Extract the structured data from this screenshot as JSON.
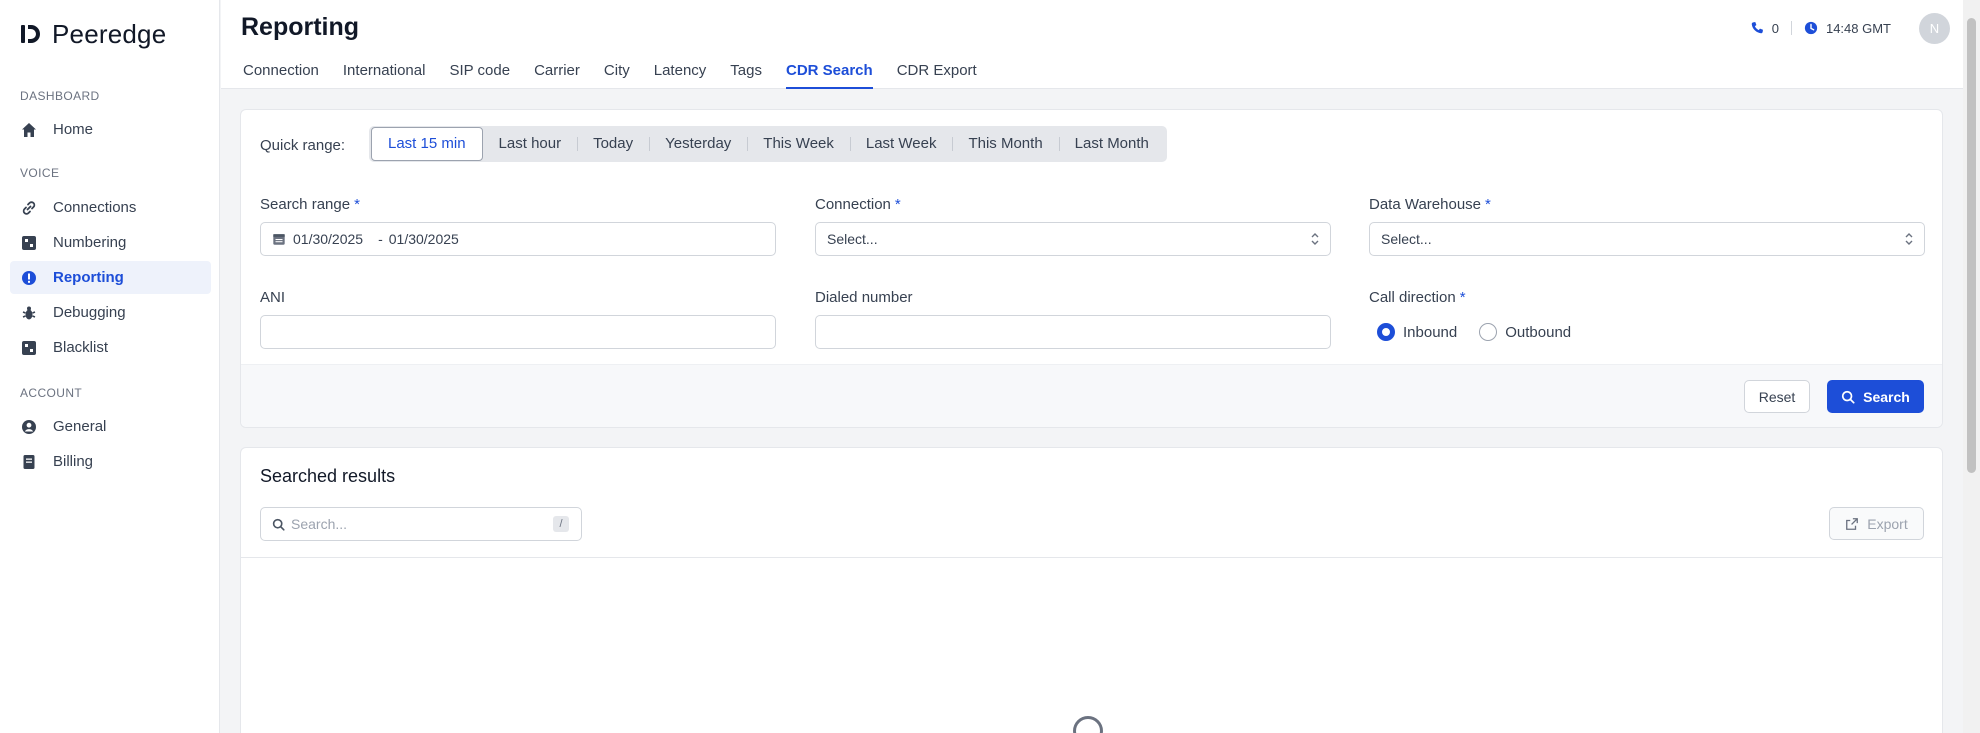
{
  "brand": {
    "name": "Peeredge"
  },
  "sidebar": {
    "sections": [
      {
        "title": "DASHBOARD"
      },
      {
        "title": "VOICE"
      },
      {
        "title": "ACCOUNT"
      }
    ],
    "items": [
      {
        "label": "Home",
        "icon": "home-icon"
      },
      {
        "label": "Connections",
        "icon": "link-icon"
      },
      {
        "label": "Numbering",
        "icon": "grid-icon"
      },
      {
        "label": "Reporting",
        "icon": "alert-circle-icon",
        "active": true
      },
      {
        "label": "Debugging",
        "icon": "bug-icon"
      },
      {
        "label": "Blacklist",
        "icon": "grid-icon"
      },
      {
        "label": "General",
        "icon": "user-circle-icon"
      },
      {
        "label": "Billing",
        "icon": "document-icon"
      }
    ]
  },
  "header": {
    "title": "Reporting",
    "tabs": [
      {
        "label": "Connection"
      },
      {
        "label": "International"
      },
      {
        "label": "SIP code"
      },
      {
        "label": "Carrier"
      },
      {
        "label": "City"
      },
      {
        "label": "Latency"
      },
      {
        "label": "Tags"
      },
      {
        "label": "CDR Search",
        "active": true
      },
      {
        "label": "CDR Export"
      }
    ],
    "calls_count": "0",
    "time": "14:48 GMT",
    "avatar_initial": "N"
  },
  "form": {
    "quick_range_label": "Quick range:",
    "quick_ranges": [
      "Last 15 min",
      "Last hour",
      "Today",
      "Yesterday",
      "This Week",
      "Last Week",
      "This Month",
      "Last Month"
    ],
    "selected_range": "Last 15 min",
    "search_range": {
      "label": "Search range",
      "from": "01/30/2025",
      "separator": "-",
      "to": "01/30/2025"
    },
    "connection": {
      "label": "Connection",
      "placeholder": "Select..."
    },
    "data_warehouse": {
      "label": "Data Warehouse",
      "placeholder": "Select..."
    },
    "ani": {
      "label": "ANI",
      "value": ""
    },
    "dialed_number": {
      "label": "Dialed number",
      "value": ""
    },
    "call_direction": {
      "label": "Call direction",
      "options": [
        "Inbound",
        "Outbound"
      ],
      "selected": "Inbound"
    },
    "required_mark": "*",
    "reset_label": "Reset",
    "search_label": "Search"
  },
  "results": {
    "title": "Searched results",
    "search_placeholder": "Search...",
    "shortcut_key": "/",
    "export_label": "Export"
  },
  "colors": {
    "accent": "#1d4ed8",
    "muted": "#6b7280",
    "background": "#f3f4f6"
  }
}
